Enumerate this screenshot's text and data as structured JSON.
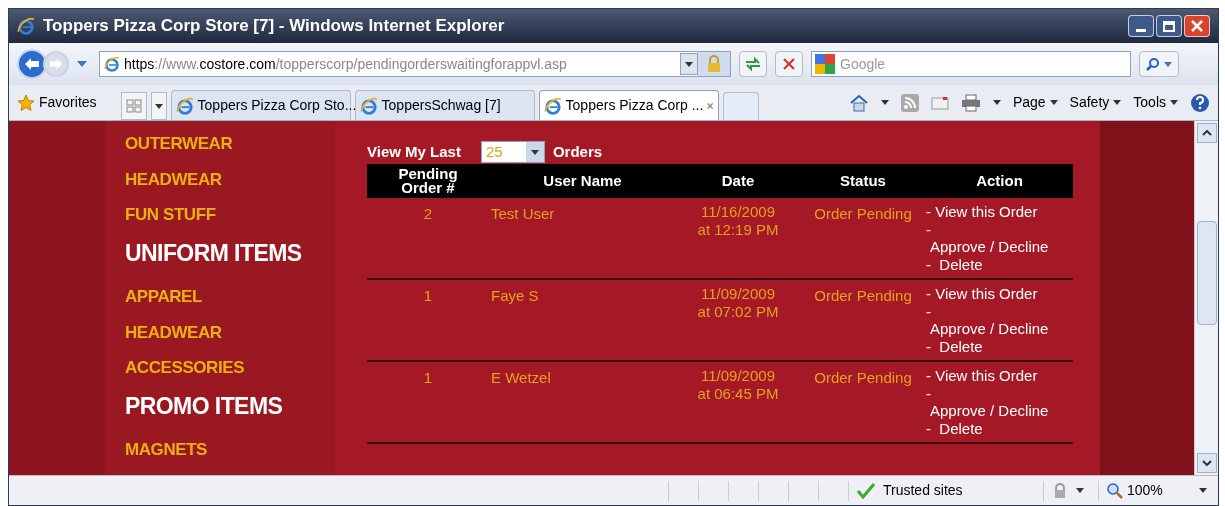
{
  "window": {
    "title": "Toppers Pizza Corp Store [7] - Windows Internet Explorer"
  },
  "address_bar": {
    "url_scheme": "https",
    "url_sep": "://www.",
    "url_host": "costore.com",
    "url_path": "/topperscorp/pendingorderswaitingforappvl.asp"
  },
  "search": {
    "placeholder": "Google"
  },
  "favorites": "Favorites",
  "tabs": [
    {
      "label": "Toppers Pizza Corp Sto...",
      "selected": false
    },
    {
      "label": "ToppersSchwag [7]",
      "selected": false
    },
    {
      "label": "Toppers Pizza Corp ...",
      "selected": true
    }
  ],
  "command_bar": [
    "Page",
    "Safety",
    "Tools"
  ],
  "sidebar": {
    "items": [
      {
        "label": "OUTERWEAR",
        "kind": "link"
      },
      {
        "label": "HEADWEAR",
        "kind": "link"
      },
      {
        "label": "FUN STUFF",
        "kind": "link"
      },
      {
        "label": "UNIFORM ITEMS",
        "kind": "heading"
      },
      {
        "label": "APPAREL",
        "kind": "link"
      },
      {
        "label": "HEADWEAR",
        "kind": "link"
      },
      {
        "label": "ACCESSORIES",
        "kind": "link"
      },
      {
        "label": "PROMO ITEMS",
        "kind": "heading"
      },
      {
        "label": "MAGNETS",
        "kind": "link"
      }
    ]
  },
  "filter": {
    "prefix": "View My Last",
    "value": "25",
    "suffix": "Orders"
  },
  "table": {
    "columns": [
      "Pending Order #",
      "User Name",
      "Date",
      "Status",
      "Action"
    ],
    "rows": [
      {
        "order": "2",
        "user": "Test User",
        "date": "11/16/2009",
        "time": "at 12:19 PM",
        "status": "Order Pending",
        "actions": [
          "- View this Order",
          "-",
          "Approve / Decline",
          "-  Delete"
        ]
      },
      {
        "order": "1",
        "user": "Faye S",
        "date": "11/09/2009",
        "time": "at 07:02 PM",
        "status": "Order Pending",
        "actions": [
          "- View this Order",
          "-",
          "Approve / Decline",
          "-  Delete"
        ]
      },
      {
        "order": "1",
        "user": "E Wetzel",
        "date": "11/09/2009",
        "time": "at 06:45 PM",
        "status": "Order Pending",
        "actions": [
          "- View this Order",
          "-",
          "Approve / Decline",
          "-  Delete"
        ]
      }
    ]
  },
  "status_bar": {
    "zone": "Trusted sites",
    "zoom": "100%"
  }
}
